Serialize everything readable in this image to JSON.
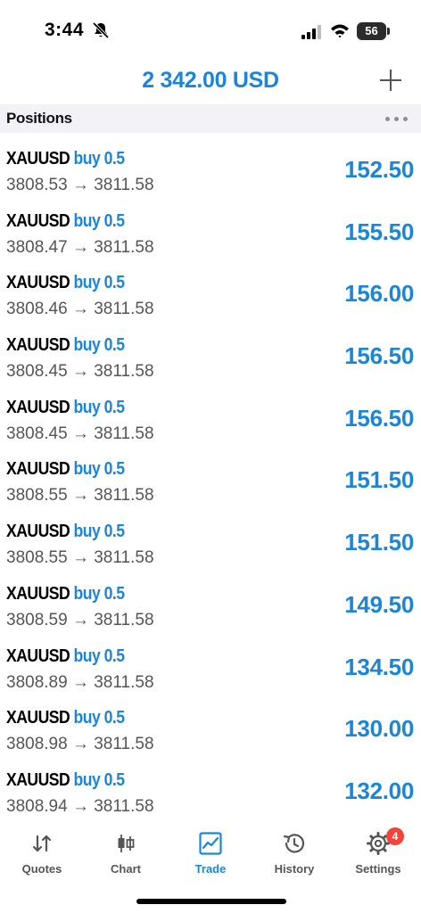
{
  "status_bar": {
    "time": "3:44",
    "battery": "56"
  },
  "header": {
    "balance": "2 342.00 USD"
  },
  "section": {
    "title": "Positions"
  },
  "positions": [
    {
      "symbol": "XAUUSD",
      "type": "buy 0.5",
      "prices": "3808.53 → 3811.58",
      "profit": "152.50"
    },
    {
      "symbol": "XAUUSD",
      "type": "buy 0.5",
      "prices": "3808.47 → 3811.58",
      "profit": "155.50"
    },
    {
      "symbol": "XAUUSD",
      "type": "buy 0.5",
      "prices": "3808.46 → 3811.58",
      "profit": "156.00"
    },
    {
      "symbol": "XAUUSD",
      "type": "buy 0.5",
      "prices": "3808.45 → 3811.58",
      "profit": "156.50"
    },
    {
      "symbol": "XAUUSD",
      "type": "buy 0.5",
      "prices": "3808.45 → 3811.58",
      "profit": "156.50"
    },
    {
      "symbol": "XAUUSD",
      "type": "buy 0.5",
      "prices": "3808.55 → 3811.58",
      "profit": "151.50"
    },
    {
      "symbol": "XAUUSD",
      "type": "buy 0.5",
      "prices": "3808.55 → 3811.58",
      "profit": "151.50"
    },
    {
      "symbol": "XAUUSD",
      "type": "buy 0.5",
      "prices": "3808.59 → 3811.58",
      "profit": "149.50"
    },
    {
      "symbol": "XAUUSD",
      "type": "buy 0.5",
      "prices": "3808.89 → 3811.58",
      "profit": "134.50"
    },
    {
      "symbol": "XAUUSD",
      "type": "buy 0.5",
      "prices": "3808.98 → 3811.58",
      "profit": "130.00"
    },
    {
      "symbol": "XAUUSD",
      "type": "buy 0.5",
      "prices": "3808.94 → 3811.58",
      "profit": "132.00"
    }
  ],
  "tabs": [
    {
      "label": "Quotes",
      "icon": "quotes-icon"
    },
    {
      "label": "Chart",
      "icon": "chart-icon"
    },
    {
      "label": "Trade",
      "icon": "trade-icon",
      "active": true
    },
    {
      "label": "History",
      "icon": "history-icon"
    },
    {
      "label": "Settings",
      "icon": "settings-icon",
      "badge": "4"
    }
  ],
  "colors": {
    "accent": "#1a86d9",
    "badge": "#f2443a"
  }
}
